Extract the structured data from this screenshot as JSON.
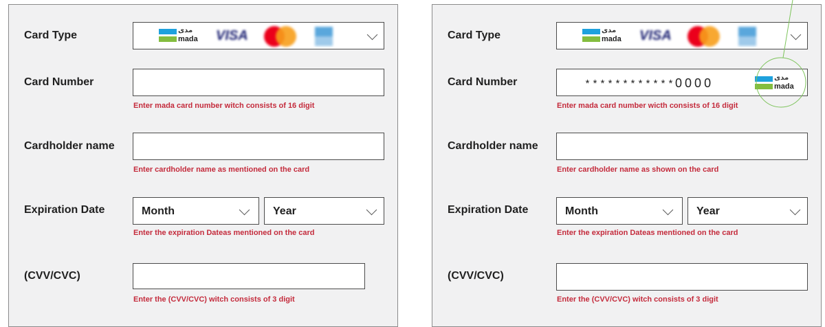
{
  "left": {
    "card_type_label": "Card Type",
    "card_number_label": "Card Number",
    "card_number_hint": "Enter mada card number witch consists of 16 digit",
    "cardholder_label": "Cardholder name",
    "cardholder_hint": "Enter cardholder name as mentioned on the card",
    "expiration_label": "Expiration Date",
    "month_value": "Month",
    "year_value": "Year",
    "expiration_hint": "Enter the expiration Dateas mentioned on the card",
    "cvv_label": "(CVV/CVC)",
    "cvv_hint": "Enter the (CVV/CVC) witch consists of 3 digit"
  },
  "right": {
    "card_type_label": "Card Type",
    "card_number_label": "Card Number",
    "card_number_masked": "************",
    "card_number_digits": "0000",
    "card_number_hint": "Enter mada card number wicth consists of 16 digit",
    "cardholder_label": "Cardholder name",
    "cardholder_hint": "Enter cardholder name as shown on the card",
    "expiration_label": "Expiration Date",
    "month_value": "Month",
    "year_value": "Year",
    "expiration_hint": "Enter the expiration Dateas mentioned on the card",
    "cvv_label": "(CVV/CVC)",
    "cvv_hint": "Enter the (CVV/CVC) witch consists of 3 digit"
  },
  "logos": {
    "mada_ar": "مدى",
    "mada_en": "mada",
    "visa": "VISA"
  },
  "colors": {
    "hint": "#c42b3c",
    "mada_blue": "#1ea1dd",
    "mada_green": "#84bd3f",
    "callout": "#7cc35a"
  },
  "icons": [
    "chevron-down-icon",
    "mada-logo",
    "visa-logo",
    "mastercard-logo",
    "amex-logo"
  ]
}
